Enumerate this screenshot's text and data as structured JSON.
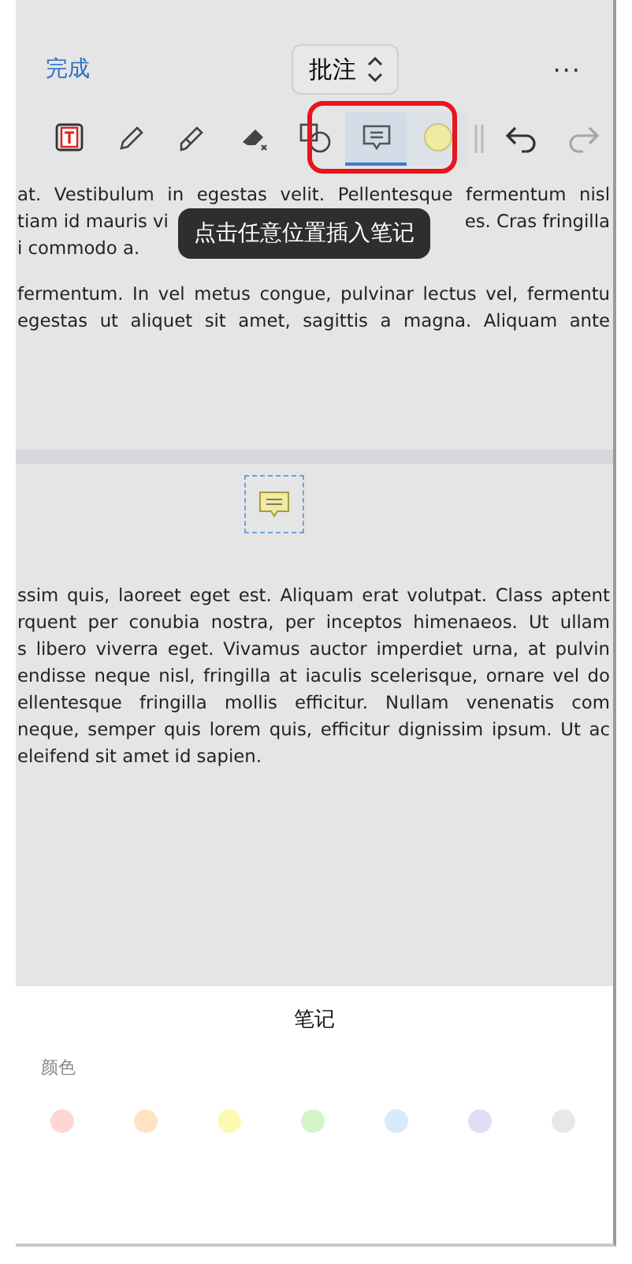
{
  "header": {
    "done": "完成",
    "mode": "批注",
    "more": "···"
  },
  "tools": [
    {
      "kind": "textbox",
      "selected": false
    },
    {
      "kind": "pen",
      "selected": false
    },
    {
      "kind": "highlighter",
      "selected": false
    },
    {
      "kind": "eraser",
      "selected": false
    },
    {
      "kind": "shapes",
      "selected": false
    },
    {
      "kind": "note",
      "selected": true
    },
    {
      "kind": "color",
      "selected": false,
      "color": "#efeba0"
    },
    {
      "kind": "undo",
      "selected": false,
      "disabled": false
    },
    {
      "kind": "redo",
      "selected": false,
      "disabled": true
    }
  ],
  "tooltip": "点击任意位置插入笔记",
  "page_1": {
    "lines": [
      {
        "parts": [
          "at. Vestibulum in egestas velit. Pellentesque fermentum nisl"
        ],
        "last": false
      },
      {
        "parts": [
          "tiam id mauris vi",
          "es. Cras fringilla"
        ]
      },
      {
        "parts": [
          "i commodo a."
        ],
        "last": true
      },
      {
        "parts": [
          "fermentum. In vel metus congue, pulvinar lectus vel, fermentu"
        ],
        "last": false
      },
      {
        "parts": [
          "egestas ut aliquet sit amet, sagittis a magna. Aliquam ante"
        ],
        "last": false
      }
    ]
  },
  "note_marker": {
    "color": "#f0eba0"
  },
  "page_2": {
    "lines": [
      {
        "parts": [
          "ssim quis, laoreet eget est. Aliquam erat volutpat. Class aptent"
        ],
        "last": false
      },
      {
        "parts": [
          "rquent per conubia nostra, per inceptos himenaeos. Ut ullam"
        ],
        "last": false
      },
      {
        "parts": [
          "s libero viverra eget. Vivamus auctor imperdiet urna, at pulvin"
        ],
        "last": false
      },
      {
        "parts": [
          "endisse neque nisl, fringilla at iaculis scelerisque, ornare vel do"
        ],
        "last": false
      },
      {
        "parts": [
          "ellentesque fringilla mollis efficitur. Nullam venenatis com"
        ],
        "last": false
      },
      {
        "parts": [
          "neque, semper quis lorem quis, efficitur dignissim ipsum. Ut ac"
        ],
        "last": false
      },
      {
        "parts": [
          "eleifend sit amet id sapien."
        ],
        "last": true
      }
    ]
  },
  "sheet": {
    "title": "笔记",
    "color_label": "颜色",
    "colors": [
      {
        "color": "#ffd6d6",
        "selected": false
      },
      {
        "color": "#ffe3c4",
        "selected": false
      },
      {
        "color": "#fdf9b4",
        "selected": false
      },
      {
        "color": "#d3f5c9",
        "selected": false
      },
      {
        "color": "#d6eafc",
        "selected": false
      },
      {
        "color": "#e3dcf7",
        "selected": false
      },
      {
        "color": "#e8e8e8",
        "selected": false
      }
    ]
  }
}
